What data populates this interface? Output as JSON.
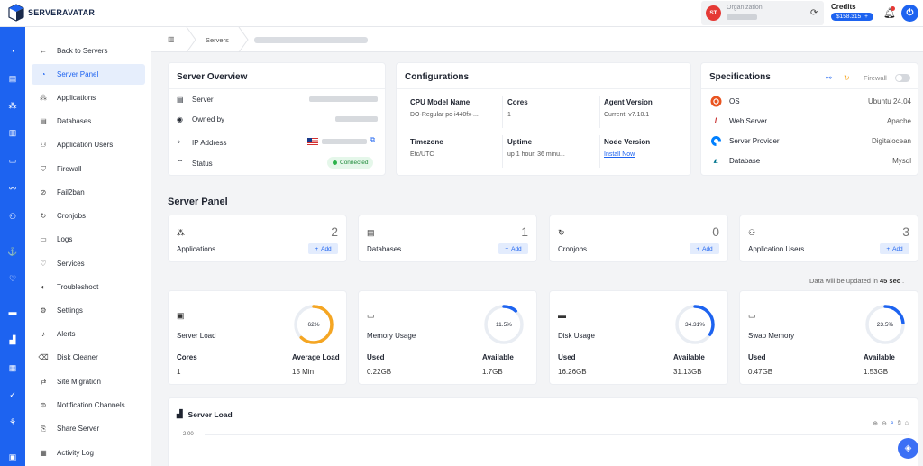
{
  "brand": {
    "name": "SERVERAVATAR"
  },
  "topbar": {
    "org_initials": "ST",
    "org_label": "Organization",
    "credits_label": "Credits",
    "credits_value": "$158.315"
  },
  "sidebar": {
    "items": [
      {
        "label": "Back to Servers",
        "icon": "arrow-left-icon",
        "glyph": "←",
        "active": false
      },
      {
        "label": "Server Panel",
        "icon": "dashboard-icon",
        "glyph": "◔",
        "active": true
      },
      {
        "label": "Applications",
        "icon": "applications-icon",
        "glyph": "⁂",
        "active": false
      },
      {
        "label": "Databases",
        "icon": "database-icon",
        "glyph": "▤",
        "active": false
      },
      {
        "label": "Application Users",
        "icon": "users-icon",
        "glyph": "⚇",
        "active": false
      },
      {
        "label": "Firewall",
        "icon": "shield-icon",
        "glyph": "⛉",
        "active": false
      },
      {
        "label": "Fail2ban",
        "icon": "ban-icon",
        "glyph": "⊘",
        "active": false
      },
      {
        "label": "Cronjobs",
        "icon": "cron-icon",
        "glyph": "↻",
        "active": false
      },
      {
        "label": "Logs",
        "icon": "logs-icon",
        "glyph": "▭",
        "active": false
      },
      {
        "label": "Services",
        "icon": "services-icon",
        "glyph": "♡",
        "active": false
      },
      {
        "label": "Troubleshoot",
        "icon": "troubleshoot-icon",
        "glyph": "◐",
        "active": false
      },
      {
        "label": "Settings",
        "icon": "gear-icon",
        "glyph": "⚙",
        "active": false
      },
      {
        "label": "Alerts",
        "icon": "bell-icon",
        "glyph": "♪",
        "active": false
      },
      {
        "label": "Disk Cleaner",
        "icon": "broom-icon",
        "glyph": "⌫",
        "active": false
      },
      {
        "label": "Site Migration",
        "icon": "migration-icon",
        "glyph": "⇄",
        "active": false
      },
      {
        "label": "Notification Channels",
        "icon": "channels-icon",
        "glyph": "⊜",
        "active": false
      },
      {
        "label": "Share Server",
        "icon": "share-icon",
        "glyph": "⎘",
        "active": false
      },
      {
        "label": "Activity Log",
        "icon": "activity-icon",
        "glyph": "▦",
        "active": false
      }
    ]
  },
  "breadcrumb": {
    "servers": "Servers"
  },
  "overview": {
    "title": "Server Overview",
    "server_label": "Server",
    "owned_label": "Owned by",
    "ip_label": "IP Address",
    "status_label": "Status",
    "status_value": "Connected"
  },
  "config": {
    "title": "Configurations",
    "cpu_label": "CPU Model Name",
    "cpu_value": "DO-Regular pc-i440fx-...",
    "cores_label": "Cores",
    "cores_value": "1",
    "agent_label": "Agent Version",
    "agent_value": "Current: v7.10.1",
    "tz_label": "Timezone",
    "tz_value": "Etc/UTC",
    "uptime_label": "Uptime",
    "uptime_value": "up 1 hour, 36 minu...",
    "node_label": "Node Version",
    "node_link": "Install Now"
  },
  "specs": {
    "title": "Specifications",
    "firewall_label": "Firewall",
    "rows": [
      {
        "name": "OS",
        "value": "Ubuntu 24.04",
        "icon": "ubuntu-icon"
      },
      {
        "name": "Web Server",
        "value": "Apache",
        "icon": "apache-icon"
      },
      {
        "name": "Server Provider",
        "value": "Digitalocean",
        "icon": "digitalocean-icon"
      },
      {
        "name": "Database",
        "value": "Mysql",
        "icon": "mysql-icon"
      }
    ]
  },
  "panel": {
    "title": "Server Panel",
    "add_label": "Add",
    "cards": [
      {
        "label": "Applications",
        "count": "2",
        "icon": "applications-icon"
      },
      {
        "label": "Databases",
        "count": "1",
        "icon": "database-icon"
      },
      {
        "label": "Cronjobs",
        "count": "0",
        "icon": "cron-icon"
      },
      {
        "label": "Application Users",
        "count": "3",
        "icon": "users-icon"
      }
    ]
  },
  "update_note": {
    "text": "Data will be updated in",
    "seconds": "45 sec",
    "suffix": "."
  },
  "metrics": [
    {
      "label": "Server Load",
      "pct_text": "62%",
      "pct": 62,
      "color": "#f5a623",
      "k1": "Cores",
      "v1": "1",
      "k2": "Average Load",
      "v2": "15 Min",
      "icon": "cpu-icon"
    },
    {
      "label": "Memory Usage",
      "pct_text": "11.5%",
      "pct": 11.5,
      "color": "#1d63f0",
      "k1": "Used",
      "v1": "0.22GB",
      "k2": "Available",
      "v2": "1.7GB",
      "icon": "memory-icon"
    },
    {
      "label": "Disk Usage",
      "pct_text": "34.31%",
      "pct": 34.31,
      "color": "#1d63f0",
      "k1": "Used",
      "v1": "16.26GB",
      "k2": "Available",
      "v2": "31.13GB",
      "icon": "disk-icon"
    },
    {
      "label": "Swap Memory",
      "pct_text": "23.5%",
      "pct": 23.5,
      "color": "#1d63f0",
      "k1": "Used",
      "v1": "0.47GB",
      "k2": "Available",
      "v2": "1.53GB",
      "icon": "swap-icon"
    }
  ],
  "server_load_chart": {
    "title": "Server Load",
    "y_tick": "2.00"
  },
  "colors": {
    "accent": "#1d63f0",
    "success": "#2bb34a",
    "warning": "#f5a623"
  }
}
